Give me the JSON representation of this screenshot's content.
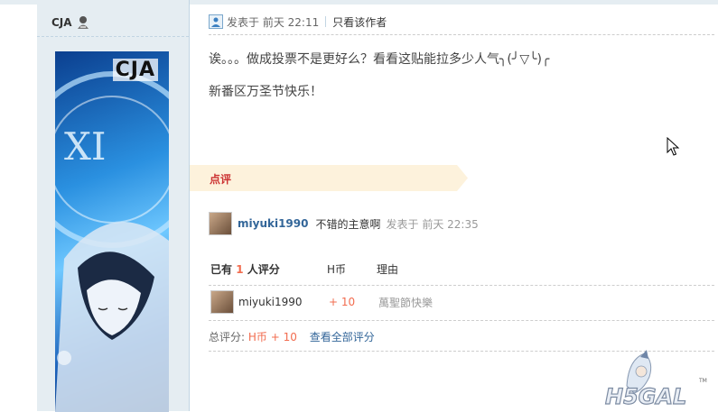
{
  "author": {
    "name": "CJA",
    "avatar_text": "CJA"
  },
  "post": {
    "posted_label": "发表于 前天 22:11",
    "author_only_link": "只看该作者",
    "lines": [
      "诶。。。做成投票不是更好么？看看这贴能拉多少人气╮(╯▽╰)╭",
      "新番区万圣节快乐！"
    ]
  },
  "comment_section": {
    "title": "点评",
    "comment": {
      "user": "miyuki1990",
      "text": "不错的主意啊",
      "time": "发表于 前天 22:35"
    }
  },
  "rating": {
    "head_prefix": "已有",
    "count": "1",
    "head_suffix": "人评分",
    "col_currency": "H币",
    "col_reason": "理由",
    "rows": [
      {
        "user": "miyuki1990",
        "score": "+ 10",
        "reason": "萬聖節快樂"
      }
    ],
    "total_label": "总评分:",
    "total_value": "H币 + 10",
    "view_all": "查看全部评分"
  },
  "watermark": {
    "text": "H5GAL",
    "tm": "TM"
  },
  "colors": {
    "accent": "#f26c4f",
    "link": "#336699",
    "sidebar": "#e5edf2",
    "comment_bar": "#fdf2dc"
  }
}
